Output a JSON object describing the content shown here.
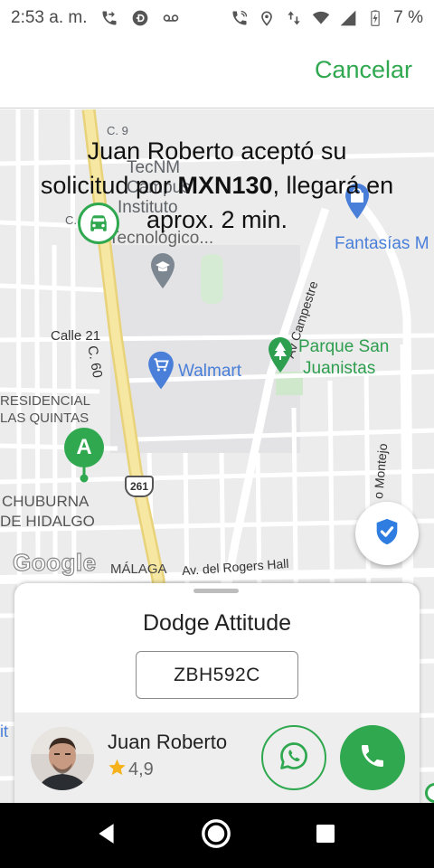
{
  "status_bar": {
    "time": "2:53 a. m.",
    "battery_percent": "7 %",
    "left_icons": [
      "phone-forward-icon",
      "data-saver-icon",
      "voicemail-icon"
    ],
    "right_icons": [
      "call-icon",
      "location-icon",
      "data-transfer-icon",
      "wifi-icon",
      "signal-icon",
      "battery-charging-icon"
    ]
  },
  "header": {
    "cancel_label": "Cancelar"
  },
  "message": {
    "line1": "Juan Roberto aceptó su",
    "line2_prefix": "solicitud por ",
    "price": "MXN130",
    "line2_suffix": ", llegará en",
    "line3": "aprox. 2 min."
  },
  "map": {
    "labels": {
      "tecnm_1": "TecNM",
      "tecnm_2": "Campus",
      "tecnm_3": "Instituto",
      "tecnm_4": "Tecnológico...",
      "c_prefix": "C.",
      "c9": "C. 9",
      "calle21": "Calle 21",
      "c60": "C. 60",
      "residencial_1": "RESIDENCIAL",
      "residencial_2": "LAS QUINTAS",
      "chuburna_1": "CHUBURNA",
      "chuburna_2": "DE HIDALGO",
      "malaga": "MÁLAGA",
      "rogers": "Av. del Rogers Hall",
      "campestre": "Av Campestre",
      "montejo": "o Montejo",
      "route_261": "261",
      "google": "Google",
      "it": "it"
    },
    "pois": {
      "walmart": "Walmart",
      "fantasias": "Fantasías M",
      "parque_1": "Parque San",
      "parque_2": "Juanistas"
    },
    "pin_letter": "A"
  },
  "trip": {
    "vehicle_model": "Dodge Attitude",
    "plate": "ZBH592C",
    "driver_name": "Juan Roberto",
    "rating": "4,9"
  },
  "colors": {
    "accent": "#2fa84f",
    "poi_blue": "#4a7fd9",
    "park_green": "#2e9e4f"
  }
}
